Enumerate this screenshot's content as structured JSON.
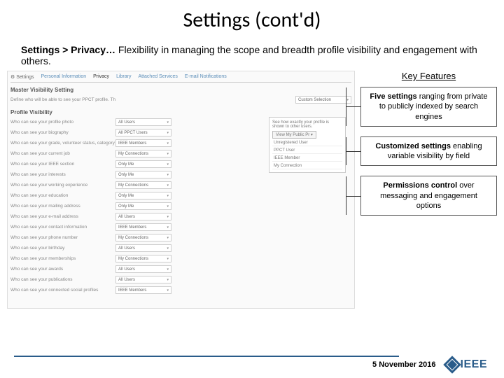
{
  "title": "Settings (cont'd)",
  "subtitle": {
    "bold": "Settings > Privacy…",
    "rest": " Flexibility in managing the scope and breadth profile visibility and engagement with others."
  },
  "screenshot": {
    "tabs": [
      "⚙ Settings",
      "Personal Information",
      "Privacy",
      "Library",
      "Attached Services",
      "E-mail Notifications"
    ],
    "master_head": "Master Visibility Setting",
    "master_sub": "Define who will be able to see your PPCT profile. This may override other visibility settings.",
    "master_select": "Custom Selection",
    "pv_head": "Profile Visibility",
    "rows": [
      {
        "lbl": "Who can see your profile photo",
        "val": "All Users"
      },
      {
        "lbl": "Who can see your biography",
        "val": "All PPCT Users"
      },
      {
        "lbl": "Who can see your grade, volunteer status, category and citation",
        "val": "IEEE Members"
      },
      {
        "lbl": "Who can see your current job",
        "val": "My Connections"
      },
      {
        "lbl": "Who can see your IEEE section",
        "val": "Only Me"
      },
      {
        "lbl": "Who can see your interests",
        "val": "Only Me"
      },
      {
        "lbl": "Who can see your working experience",
        "val": "My Connections"
      },
      {
        "lbl": "Who can see your education",
        "val": "Only Me"
      },
      {
        "lbl": "Who can see your mailing address",
        "val": "Only Me"
      },
      {
        "lbl": "Who can see your e-mail address",
        "val": "All Users"
      },
      {
        "lbl": "Who can see your contact information",
        "val": "IEEE Members"
      },
      {
        "lbl": "Who can see your phone number",
        "val": "My Connections"
      },
      {
        "lbl": "Who can see your birthday",
        "val": "All Users"
      },
      {
        "lbl": "Who can see your memberships",
        "val": "My Connections"
      },
      {
        "lbl": "Who can see your awards",
        "val": "All Users"
      },
      {
        "lbl": "Who can see your publications",
        "val": "All Users"
      },
      {
        "lbl": "Who can see your connected social profiles",
        "val": "IEEE Members"
      }
    ],
    "preview": {
      "text": "See how exactly your profile is shown to other users.",
      "btn": "View My Public Pr ▾",
      "opts": [
        "Unregistered User",
        "PPCT User",
        "IEEE Member",
        "My Connection"
      ]
    }
  },
  "key_features": {
    "head": "Key Features",
    "items": [
      {
        "lead": "Five settings",
        "rest": " ranging from private to publicly indexed by search engines"
      },
      {
        "lead": "Customized settings",
        "rest": " enabling variable visibility by field"
      },
      {
        "lead": "Permissions control",
        "rest": " over messaging and engagement options"
      }
    ]
  },
  "footer": {
    "date": "5 November 2016",
    "logo": "IEEE"
  }
}
